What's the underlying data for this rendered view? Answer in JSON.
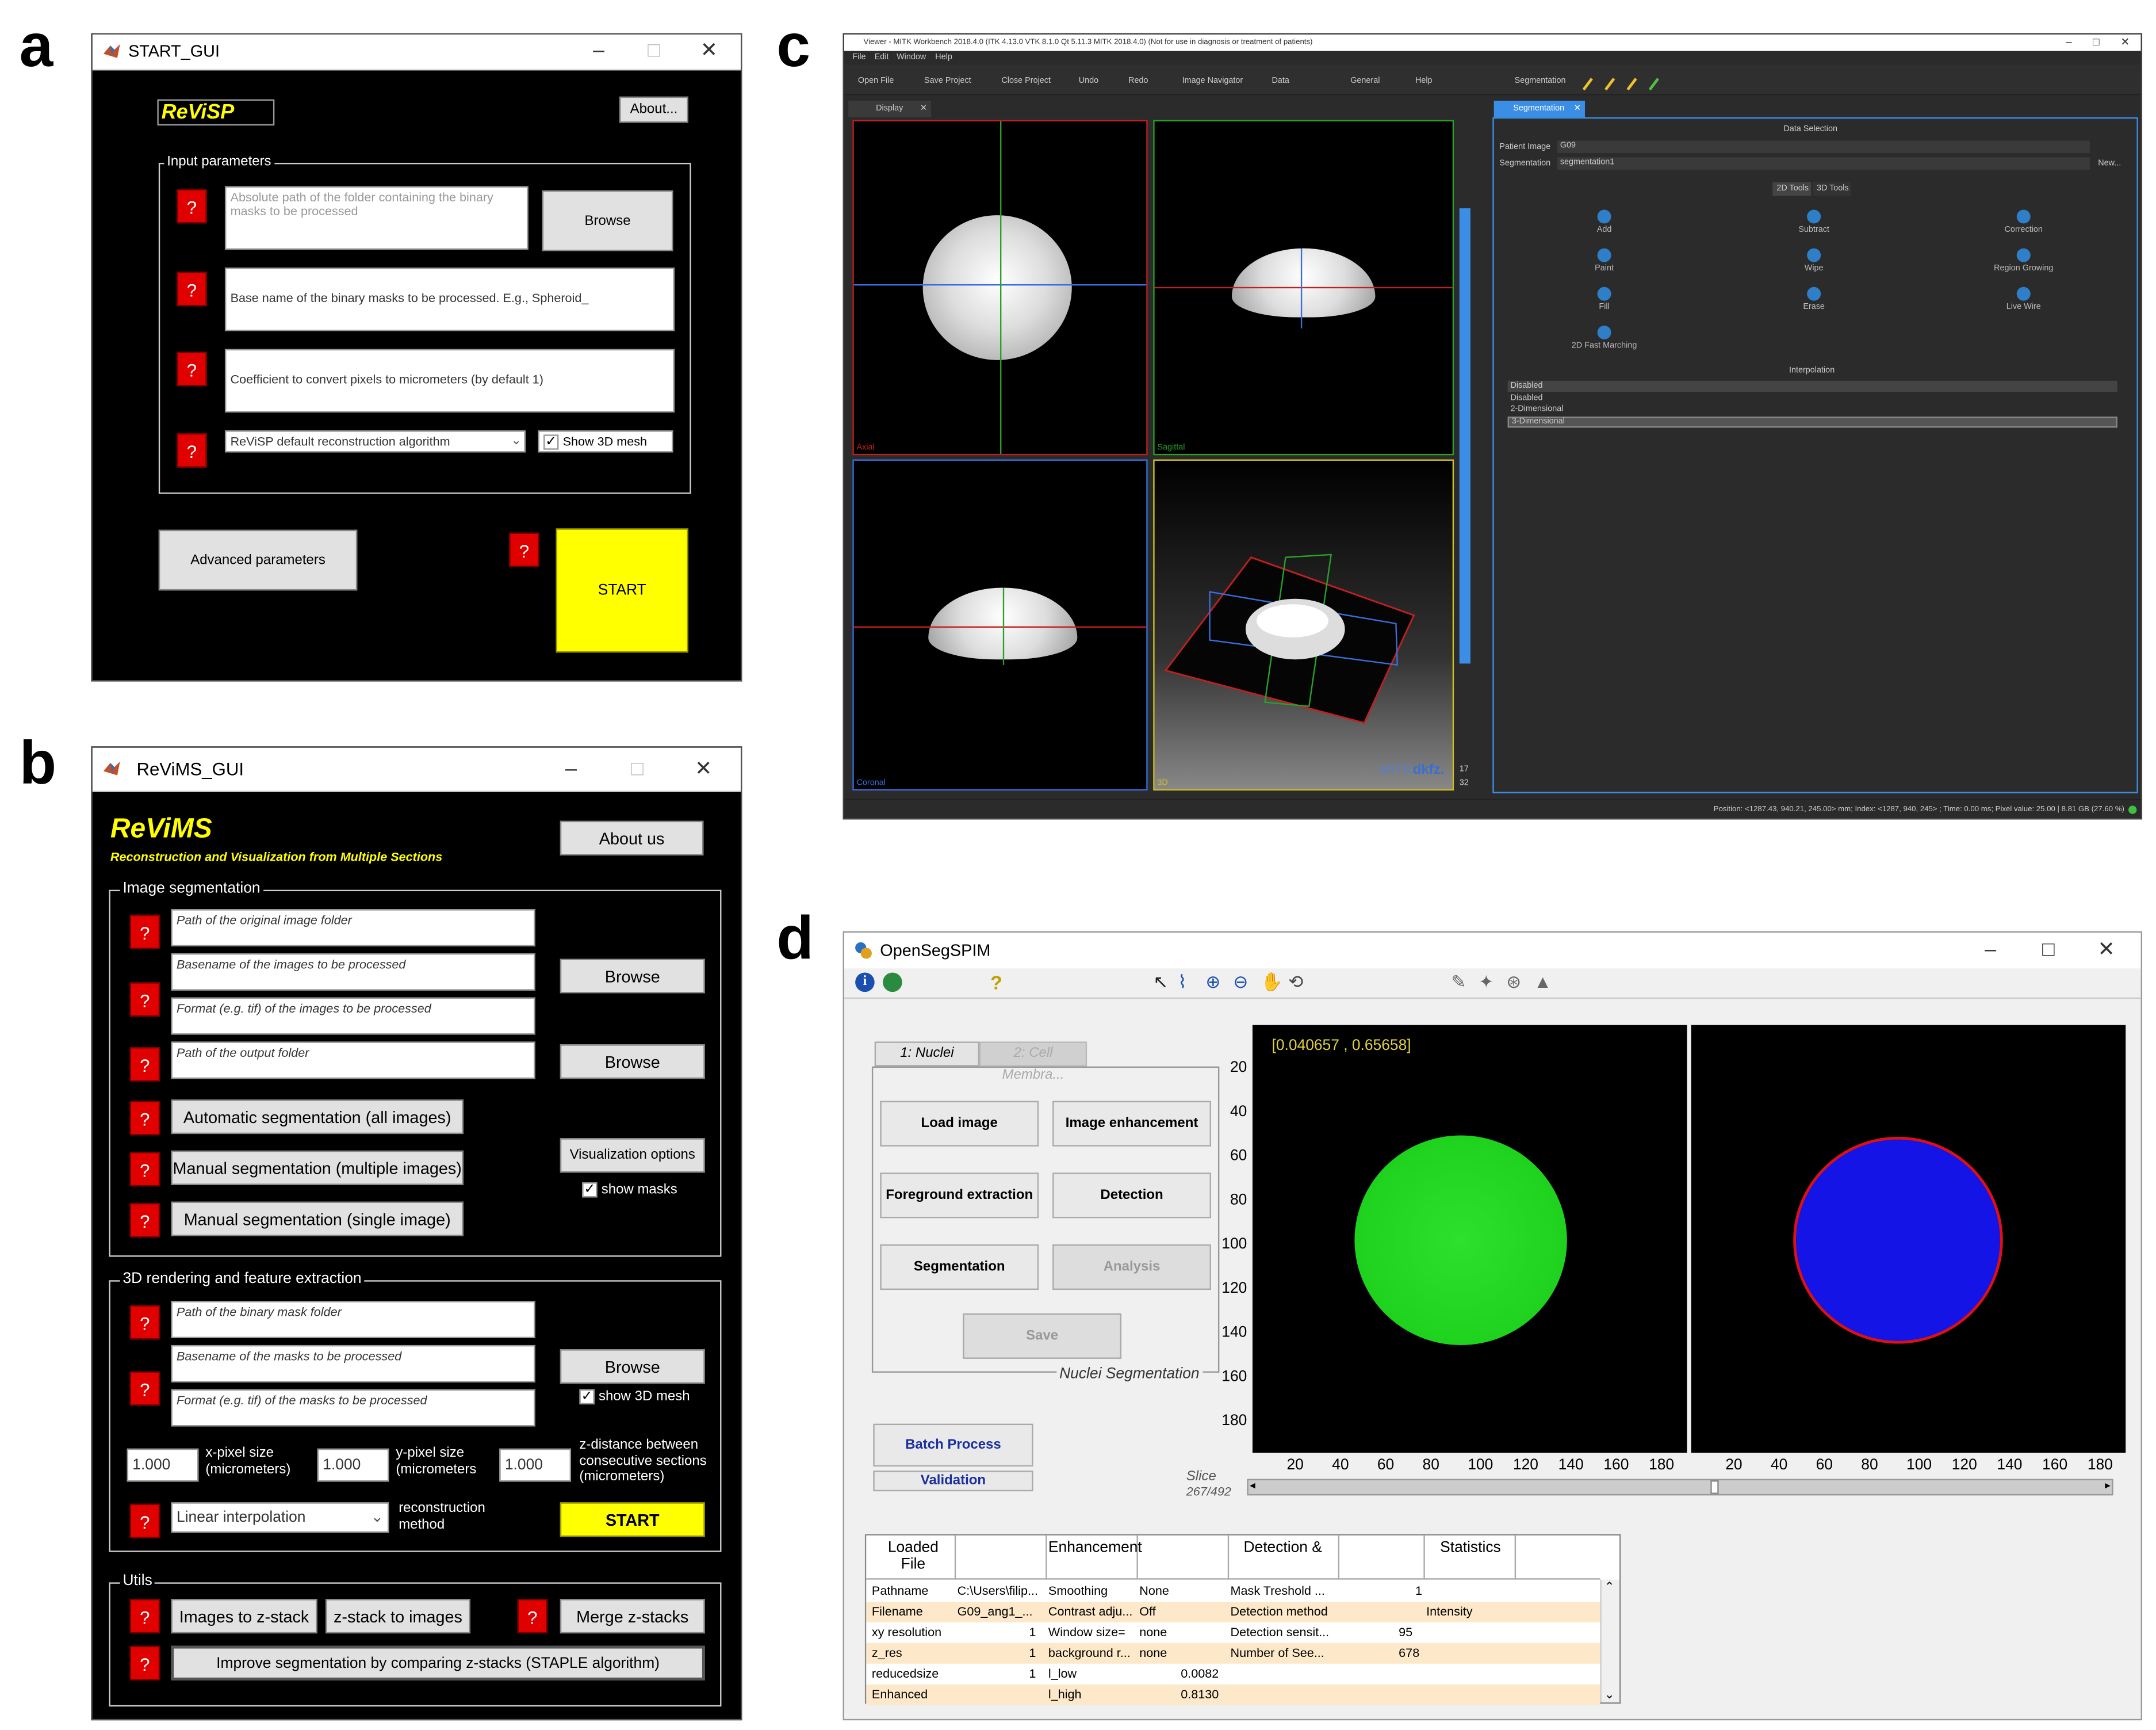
{
  "labels": {
    "a": "a",
    "b": "b",
    "c": "c",
    "d": "d"
  },
  "panel_a": {
    "title": "START_GUI",
    "logo": "ReViSP",
    "about_label": "About...",
    "group_label": "Input parameters",
    "folder_placeholder": "Absolute path of the folder containing the binary masks to be processed",
    "browse_label": "Browse",
    "basename_value": "Base name of the binary masks to be processed. E.g., Spheroid_",
    "coef_value": "Coefficient to convert pixels to micrometers (by default 1)",
    "algorithm_value": "ReViSP default reconstruction algorithm",
    "show_mesh_label": "Show 3D mesh",
    "advanced_label": "Advanced parameters",
    "start_label": "START",
    "help": "?"
  },
  "panel_b": {
    "title": "ReViMS_GUI",
    "logo": "ReViMS",
    "subtitle": "Reconstruction and Visualization from Multiple Sections",
    "about_label": "About us",
    "help": "?",
    "seg_group": "Image segmentation",
    "seg_fields": [
      "Path of the original image folder",
      "Basename of the images to be processed",
      "Format (e.g. tif) of the images to be processed",
      "Path of the output folder"
    ],
    "browse_label": "Browse",
    "auto_seg": "Automatic segmentation (all images)",
    "manual_multi": "Manual segmentation (multiple images)",
    "manual_single": "Manual segmentation (single image)",
    "vis_options": "Visualization options",
    "show_masks": "show masks",
    "render_group": "3D rendering and feature extraction",
    "render_fields": [
      "Path of the binary mask folder",
      "Basename of the masks to be processed",
      "Format (e.g. tif) of the masks to be processed"
    ],
    "show_mesh": "show 3D mesh",
    "x_value": "1.000",
    "x_label": "x-pixel size (micrometers)",
    "y_value": "1.000",
    "y_label": "y-pixel size (micrometers",
    "z_value": "1.000",
    "z_label": "z-distance between consecutive sections (micrometers)",
    "method_value": "Linear interpolation",
    "method_label": "reconstruction method",
    "start_label": "START",
    "utils_group": "Utils",
    "img_to_z": "Images to z-stack",
    "z_to_img": "z-stack to images",
    "merge": "Merge z-stacks",
    "improve": "Improve segmentation by comparing z-stacks (STAPLE algorithm)"
  },
  "panel_c": {
    "title": "Viewer - MITK Workbench 2018.4.0 (ITK 4.13.0  VTK 8.1.0 Qt 5.11.3 MITK 2018.4.0) (Not for use in diagnosis or treatment of patients)",
    "menu": [
      "File",
      "Edit",
      "Window",
      "Help"
    ],
    "toolbar": [
      "Open File",
      "Save Project",
      "Close Project",
      "Undo",
      "Redo",
      "Image Navigator",
      "Data",
      "General",
      "Help",
      "Segmentation"
    ],
    "display_tab": "Display",
    "seg_tab": "Segmentation",
    "data_selection": "Data Selection",
    "patient_label": "Patient Image",
    "patient_value": "G09",
    "seg_label": "Segmentation",
    "seg_value": "segmentation1",
    "new_label": "New...",
    "tools_2d": "2D Tools",
    "tools_3d": "3D Tools",
    "tools": [
      "Add",
      "Subtract",
      "Correction",
      "Paint",
      "Wipe",
      "Region Growing",
      "Fill",
      "Erase",
      "Live Wire",
      "2D Fast Marching"
    ],
    "interp_header": "Interpolation",
    "interp_options": [
      "Disabled",
      "Disabled",
      "2-Dimensional",
      "3-Dimensional"
    ],
    "view_names": [
      "Axial",
      "Sagittal",
      "Coronal",
      "3D"
    ],
    "brand_a": "MITK",
    "brand_b": "dkfz.",
    "slider_bottom": [
      "17",
      "32"
    ],
    "status": "Position: <1287.43, 940.21, 245.00> mm; Index: <1287, 940, 245> ; Time: 0.00 ms; Pixel value: 25.00 | 8.81 GB (27.60 %)"
  },
  "panel_d": {
    "title": "OpenSegSPIM",
    "tab1": "1: Nuclei",
    "tab2": "2: Cell Membra...",
    "load": "Load image",
    "enhance": "Image enhancement",
    "fg": "Foreground extraction",
    "detect": "Detection",
    "seg": "Segmentation",
    "analysis": "Analysis",
    "save": "Save",
    "group_label": "Nuclei Segmentation",
    "batch": "Batch Process",
    "validation": "Validation",
    "coord": "[0.040657 , 0.65658]",
    "y_ticks": [
      "20",
      "40",
      "60",
      "80",
      "100",
      "120",
      "140",
      "160",
      "180"
    ],
    "x_ticks": [
      "20",
      "40",
      "60",
      "80",
      "100",
      "120",
      "140",
      "160",
      "180"
    ],
    "slice_label": "Slice",
    "slice_value": "267/492",
    "table_headers": [
      "Loaded File",
      "",
      "Enhancement",
      "",
      "Detection &",
      "",
      "Statistics"
    ],
    "rows": [
      [
        "Pathname",
        "C:\\Users\\filip...",
        "Smoothing",
        "None",
        "Mask Treshold ...",
        "1"
      ],
      [
        "Filename",
        "G09_ang1_...",
        "Contrast adju...",
        "Off",
        "Detection method",
        "Intensity"
      ],
      [
        "xy resolution",
        "1",
        "Window size=",
        "none",
        "Detection sensit...",
        "95"
      ],
      [
        "z_res",
        "1",
        "background r...",
        "none",
        "Number of See...",
        "678"
      ],
      [
        "reducedsize",
        "1",
        "l_low",
        "0.0082",
        "",
        ""
      ],
      [
        "Enhanced",
        "",
        "l_high",
        "0.8130",
        "",
        ""
      ]
    ]
  },
  "colors": {
    "help_red": "#e00000",
    "start_yellow": "#ffff00",
    "mitk_accent": "#3a8ee6",
    "nucleus_green": "#1ed21e",
    "nucleus_blue": "#1414e6",
    "contour_red": "#e01010"
  }
}
